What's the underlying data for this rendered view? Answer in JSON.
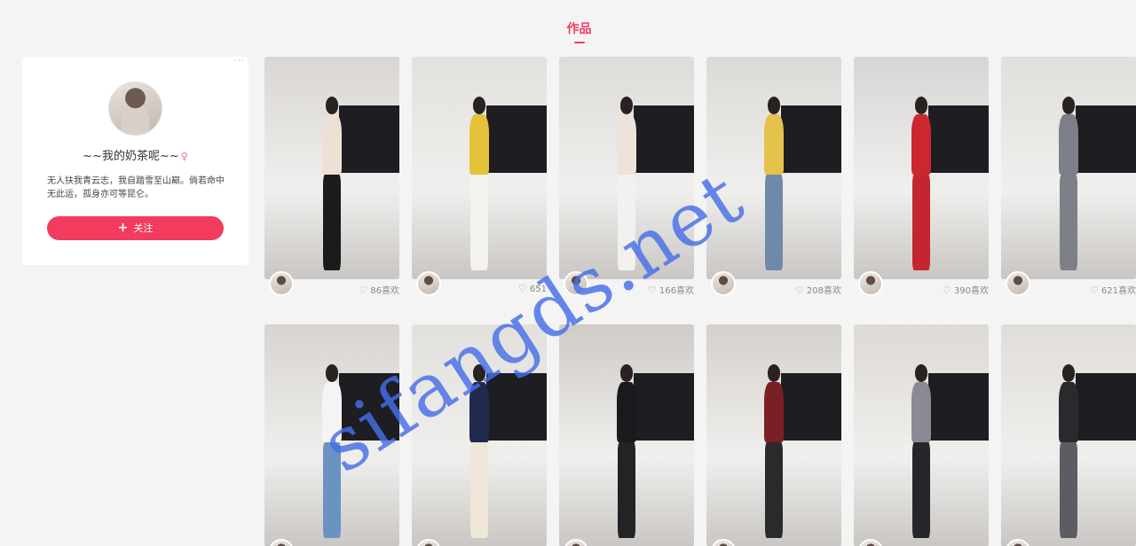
{
  "tab": {
    "title": "作品"
  },
  "profile": {
    "more": "···",
    "nickname": "~~我的奶茶呢~~",
    "gender": "♀",
    "bio": "无人扶我青云志，我自踏雪至山巅。倘若命中无此运，孤身亦可等昆仑。",
    "follow_plus": "+",
    "follow_label": "关注"
  },
  "videos": [
    {
      "likes": "86喜欢",
      "wall": "#d9d6d3",
      "top": "#efe0d6",
      "bottom": "#1b1b1e"
    },
    {
      "likes": "651",
      "wall": "#e3e1de",
      "top": "#e3c23a",
      "bottom": "#f4f2ef"
    },
    {
      "likes": "166喜欢",
      "wall": "#dedcd9",
      "top": "#ece3da",
      "bottom": "#f3f1ef"
    },
    {
      "likes": "208喜欢",
      "wall": "#dcdad7",
      "top": "#e4c24c",
      "bottom": "#6f8aa8"
    },
    {
      "likes": "390喜欢",
      "wall": "#d8d6d4",
      "top": "#cc2730",
      "bottom": "#c42630"
    },
    {
      "likes": "621喜欢",
      "wall": "#e1dfdc",
      "top": "#7d8088",
      "bottom": "#7d8088"
    },
    {
      "likes": "",
      "wall": "#d7d4d1",
      "top": "#f4f4f4",
      "bottom": "#6b93c2"
    },
    {
      "likes": "",
      "wall": "#e2e0dd",
      "top": "#1f2a4d",
      "bottom": "#efe6d8"
    },
    {
      "likes": "",
      "wall": "#cfcbc7",
      "top": "#1a1a1c",
      "bottom": "#232326"
    },
    {
      "likes": "",
      "wall": "#d4d0cc",
      "top": "#7a1f26",
      "bottom": "#2a2a2d"
    },
    {
      "likes": "",
      "wall": "#ddd9d4",
      "top": "#8a8a94",
      "bottom": "#26262a"
    },
    {
      "likes": "",
      "wall": "#e0ddd9",
      "top": "#2a2a2e",
      "bottom": "#5c5d62"
    }
  ],
  "icons": {
    "heart": "♡",
    "more": "more-icon"
  },
  "watermark": "sifangds.net",
  "colors": {
    "accent": "#f23b5e",
    "watermark": "#466ee6"
  }
}
